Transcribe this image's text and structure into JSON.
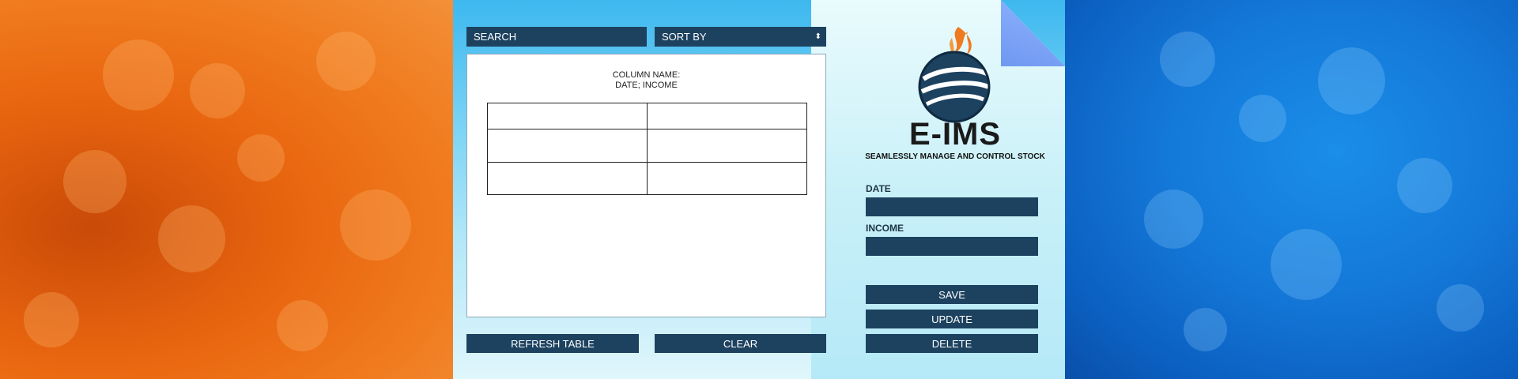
{
  "search": {
    "placeholder": "SEARCH"
  },
  "sort": {
    "label": "SORT BY",
    "arrow": "⬍"
  },
  "table": {
    "column_name_line1": "COLUMN NAME:",
    "column_name_line2": "DATE; INCOME",
    "rows": [
      [
        "",
        ""
      ],
      [
        "",
        ""
      ],
      [
        "",
        ""
      ]
    ]
  },
  "buttons": {
    "refresh": "REFRESH TABLE",
    "clear": "CLEAR",
    "save": "SAVE",
    "update": "UPDATE",
    "delete": "DELETE"
  },
  "brand": {
    "name": "E-IMS",
    "tagline": "SEAMLESSLY MANAGE AND CONTROL STOCK"
  },
  "form": {
    "date_label": "DATE",
    "date_value": "",
    "income_label": "INCOME",
    "income_value": ""
  },
  "colors": {
    "accent": "#1d4260",
    "flame": "#f07a1e"
  }
}
